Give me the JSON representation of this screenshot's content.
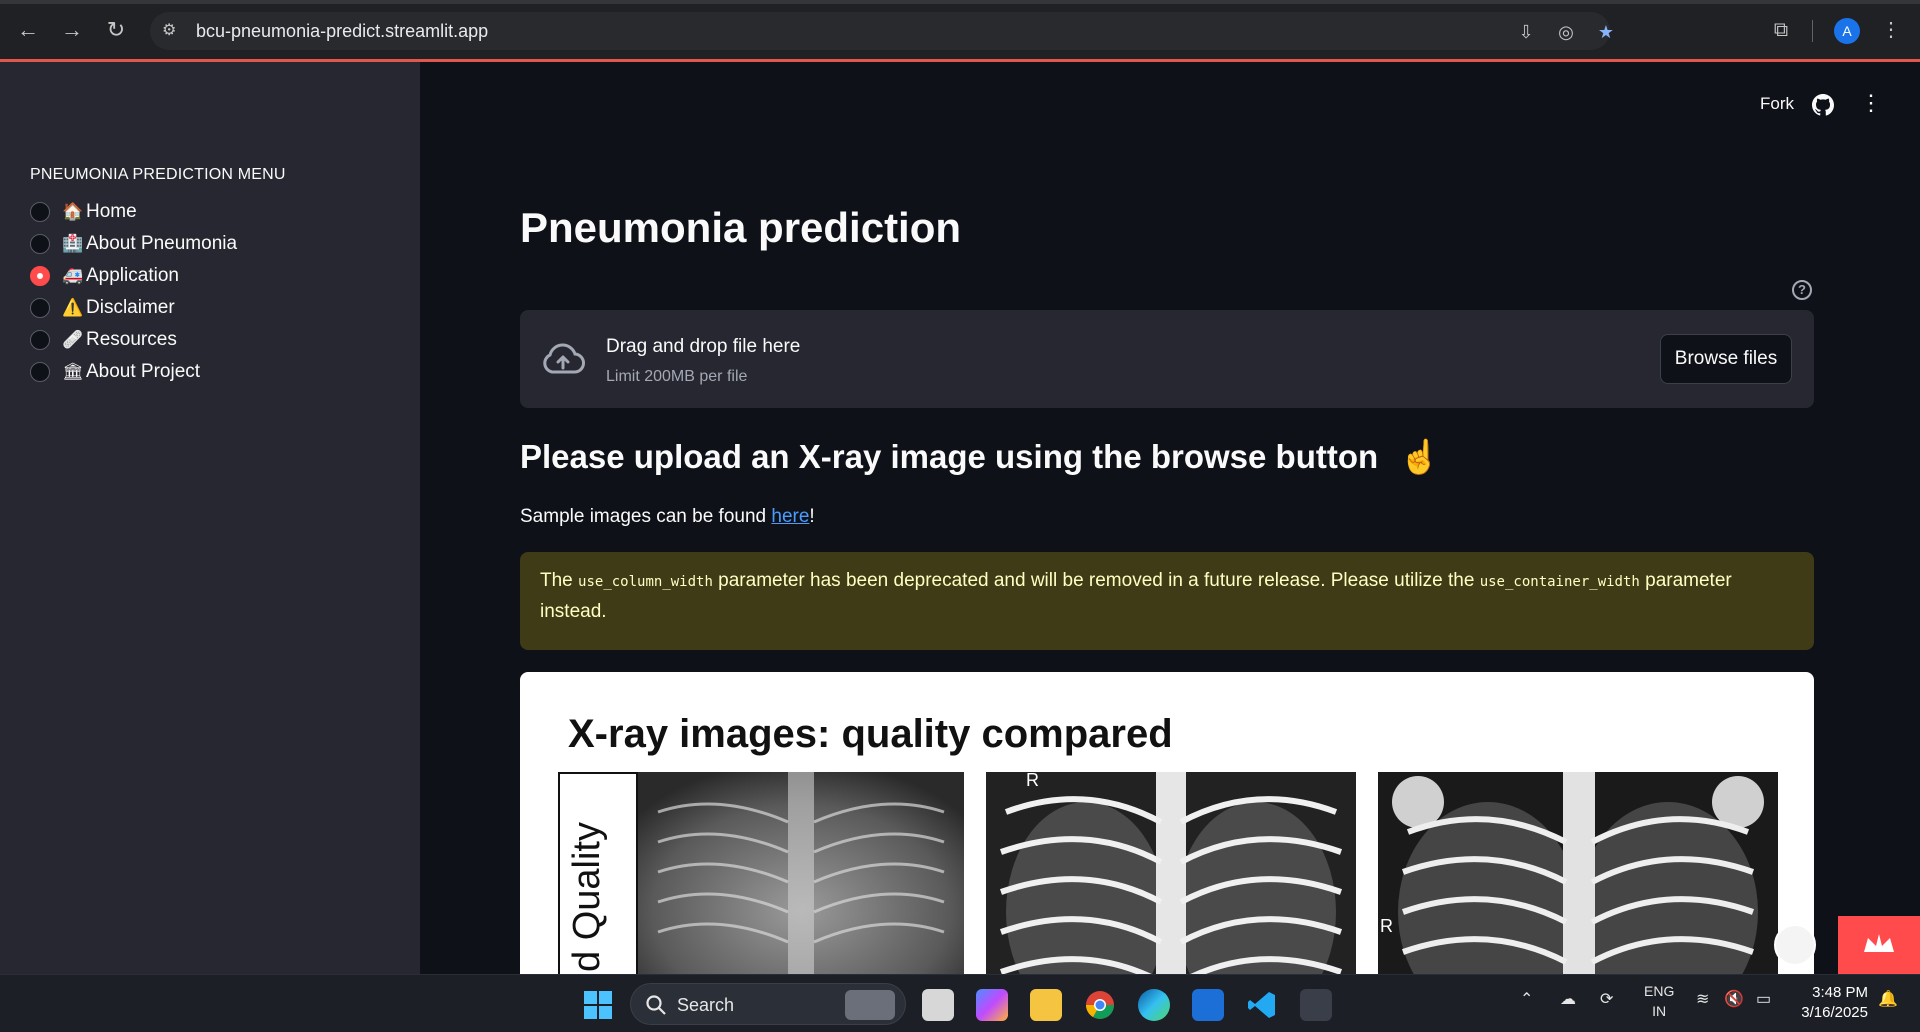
{
  "browser": {
    "url": "bcu-pneumonia-predict.streamlit.app",
    "profile_initial": "A"
  },
  "sidebar": {
    "menu_title": "PNEUMONIA PREDICTION MENU",
    "items": [
      {
        "emoji": "🏠",
        "label": "Home",
        "selected": false
      },
      {
        "emoji": "🏥",
        "label": "About Pneumonia",
        "selected": false
      },
      {
        "emoji": "🚑",
        "label": "Application",
        "selected": true
      },
      {
        "emoji": "⚠️",
        "label": "Disclaimer",
        "selected": false
      },
      {
        "emoji": "🩹",
        "label": "Resources",
        "selected": false
      },
      {
        "emoji": "🏛",
        "label": "About Project",
        "selected": false
      }
    ]
  },
  "header": {
    "fork_label": "Fork"
  },
  "main": {
    "title": "Pneumonia prediction",
    "uploader": {
      "drag_text": "Drag and drop file here",
      "limit_text": "Limit 200MB per file",
      "browse_label": "Browse files"
    },
    "subheader": "Please upload an X-ray image using the browse button",
    "subheader_emoji": "☝️",
    "sample_prefix": "Sample images can be found ",
    "sample_link": "here",
    "sample_suffix": "!",
    "warning": {
      "w1": "The ",
      "code1": "use_column_width",
      "w2": " parameter has been deprecated and will be removed in a future release. Please utilize the ",
      "code2": "use_container_width",
      "w3": " parameter instead."
    },
    "image": {
      "title": "X-ray images: quality compared",
      "side_label": "d Quality",
      "marker_r": "R"
    }
  },
  "taskbar": {
    "search_label": "Search",
    "lang_top": "ENG",
    "lang_bottom": "IN",
    "time": "3:48 PM",
    "date": "3/16/2025"
  },
  "colors": {
    "accent": "#ff4b4b",
    "link": "#4a9cff",
    "warning_bg": "#3e3b16",
    "warning_text": "#ffffc2"
  }
}
